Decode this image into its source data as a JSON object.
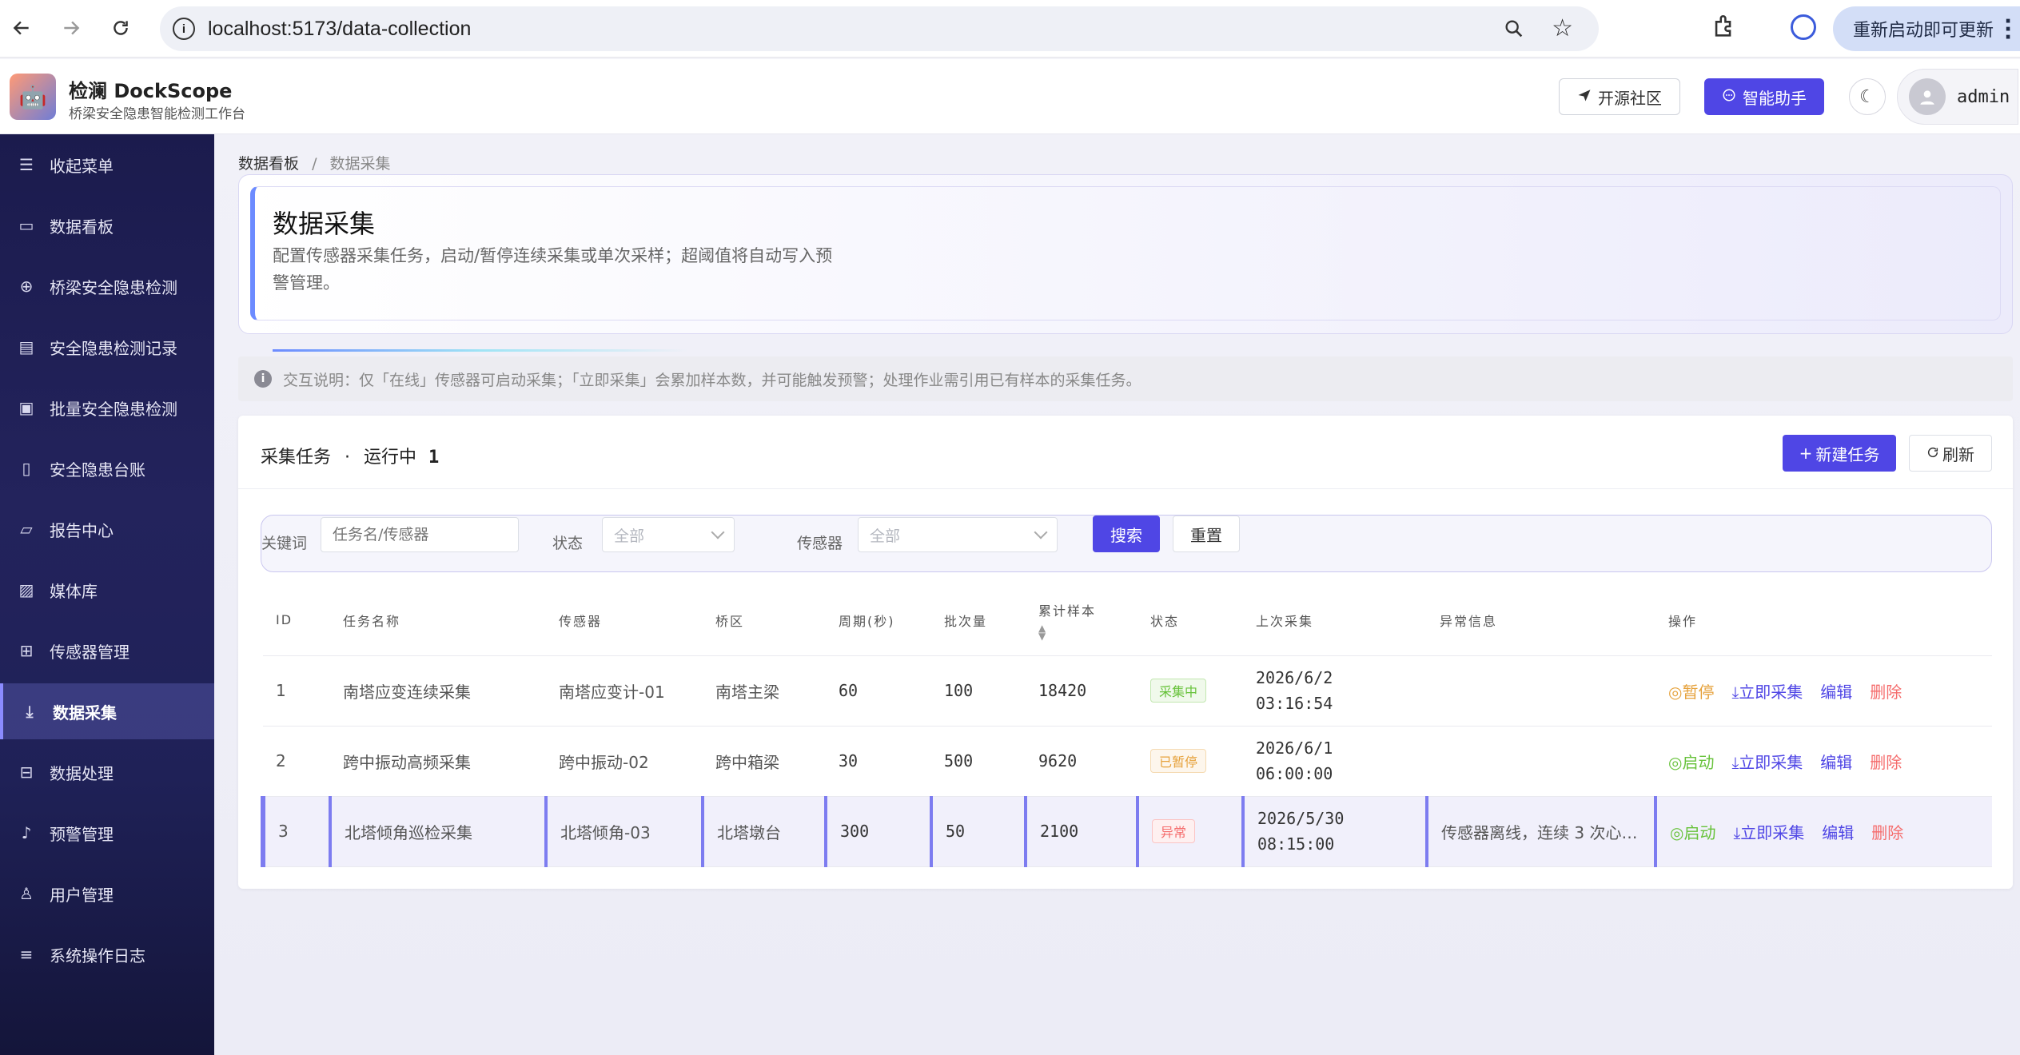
{
  "browser": {
    "url": "localhost:5173/data-collection",
    "update_label": "重新启动即可更新"
  },
  "header": {
    "brand_title": "检澜 DockScope",
    "brand_subtitle": "桥梁安全隐患智能检测工作台",
    "community_label": "开源社区",
    "assistant_label": "智能助手",
    "username": "admin"
  },
  "sidebar": {
    "items": [
      {
        "label": "收起菜单",
        "icon": "collapse-icon"
      },
      {
        "label": "数据看板",
        "icon": "dashboard-icon"
      },
      {
        "label": "桥梁安全隐患检测",
        "icon": "detect-icon"
      },
      {
        "label": "安全隐患检测记录",
        "icon": "record-icon"
      },
      {
        "label": "批量安全隐患检测",
        "icon": "batch-icon"
      },
      {
        "label": "安全隐患台账",
        "icon": "ledger-icon"
      },
      {
        "label": "报告中心",
        "icon": "folder-icon"
      },
      {
        "label": "媒体库",
        "icon": "image-icon"
      },
      {
        "label": "传感器管理",
        "icon": "chip-icon"
      },
      {
        "label": "数据采集",
        "icon": "download-icon"
      },
      {
        "label": "数据处理",
        "icon": "process-icon"
      },
      {
        "label": "预警管理",
        "icon": "bell-icon"
      },
      {
        "label": "用户管理",
        "icon": "user-icon"
      },
      {
        "label": "系统操作日志",
        "icon": "sliders-icon"
      }
    ],
    "active_index": 9
  },
  "breadcrumb": {
    "parent": "数据看板",
    "separator": "/",
    "current": "数据采集"
  },
  "hero": {
    "title": "数据采集",
    "description": "配置传感器采集任务，启动/暂停连续采集或单次采样；超阈值将自动写入预警管理。"
  },
  "notice": {
    "text": "交互说明：仅「在线」传感器可启动采集；「立即采集」会累加样本数，并可能触发预警；处理作业需引用已有样本的采集任务。"
  },
  "card": {
    "title": "采集任务",
    "running_label": "运行中",
    "running_count": "1",
    "new_label": "新建任务",
    "refresh_label": "刷新"
  },
  "filter": {
    "keyword_label": "关键词",
    "keyword_placeholder": "任务名/传感器",
    "status_label": "状态",
    "status_value": "全部",
    "sensor_label": "传感器",
    "sensor_value": "全部",
    "search_label": "搜索",
    "reset_label": "重置"
  },
  "table": {
    "columns": [
      "ID",
      "任务名称",
      "传感器",
      "桥区",
      "周期(秒)",
      "批次量",
      "累计样本",
      "状态",
      "上次采集",
      "异常信息",
      "操作"
    ],
    "rows": [
      {
        "id": "1",
        "name": "南塔应变连续采集",
        "sensor": "南塔应变计-01",
        "zone": "南塔主梁",
        "period": "60",
        "batch": "100",
        "samples": "18420",
        "status": "采集中",
        "status_kind": "run",
        "last_date": "2026/6/2",
        "last_time": "03:16:54",
        "error": "",
        "toggle_label": "暂停",
        "collect_label": "立即采集",
        "edit_label": "编辑",
        "delete_label": "删除"
      },
      {
        "id": "2",
        "name": "跨中振动高频采集",
        "sensor": "跨中振动-02",
        "zone": "跨中箱梁",
        "period": "30",
        "batch": "500",
        "samples": "9620",
        "status": "已暂停",
        "status_kind": "pause",
        "last_date": "2026/6/1",
        "last_time": "06:00:00",
        "error": "",
        "toggle_label": "启动",
        "collect_label": "立即采集",
        "edit_label": "编辑",
        "delete_label": "删除"
      },
      {
        "id": "3",
        "name": "北塔倾角巡检采集",
        "sensor": "北塔倾角-03",
        "zone": "北塔墩台",
        "period": "300",
        "batch": "50",
        "samples": "2100",
        "status": "异常",
        "status_kind": "err",
        "last_date": "2026/5/30",
        "last_time": "08:15:00",
        "error": "传感器离线，连续 3 次心…",
        "toggle_label": "启动",
        "collect_label": "立即采集",
        "edit_label": "编辑",
        "delete_label": "删除"
      }
    ]
  },
  "colors": {
    "accent": "#4f46e5",
    "sidebar_bg": "#1b1b4d",
    "status_run": "#67c23a",
    "status_pause": "#e6a23c",
    "status_error": "#f56c6c"
  }
}
